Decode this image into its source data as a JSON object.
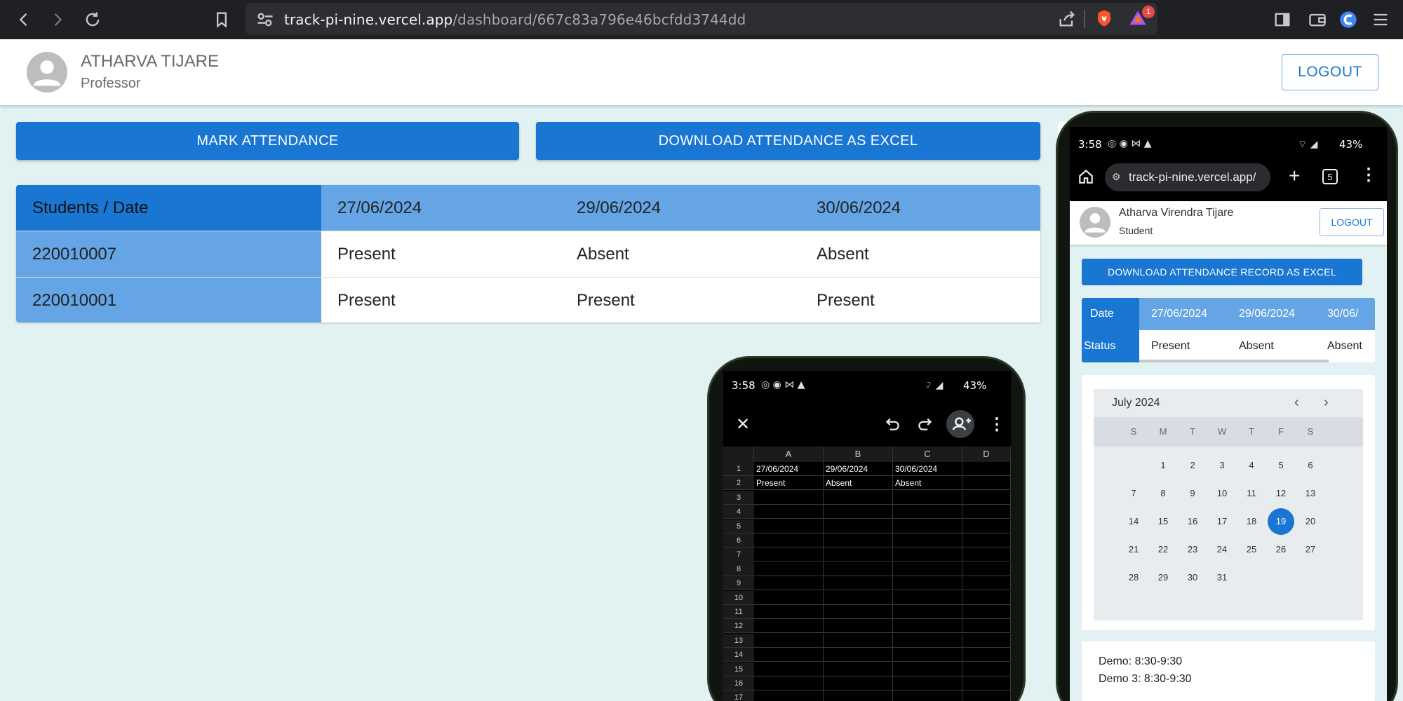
{
  "browser": {
    "url_host": "track-pi-nine.vercel.app",
    "url_path": "/dashboard/667c83a796e46bcfdd3744dd",
    "brave_badge": "1"
  },
  "header": {
    "user_name": "ATHARVA TIJARE",
    "user_role": "Professor",
    "logout_label": "LOGOUT"
  },
  "actions": {
    "mark_label": "MARK ATTENDANCE",
    "download_label": "DOWNLOAD ATTENDANCE AS EXCEL"
  },
  "table": {
    "corner": "Students / Date",
    "dates": [
      "27/06/2024",
      "29/06/2024",
      "30/06/2024"
    ],
    "rows": [
      {
        "id": "220010007",
        "values": [
          "Present",
          "Absent",
          "Absent"
        ]
      },
      {
        "id": "220010001",
        "values": [
          "Present",
          "Present",
          "Present"
        ]
      }
    ]
  },
  "sheets_phone": {
    "time": "3:58",
    "battery": "43%",
    "columns": [
      "A",
      "B",
      "C",
      "D"
    ],
    "rows": [
      [
        "27/06/2024",
        "29/06/2024",
        "30/06/2024",
        ""
      ],
      [
        "Present",
        "Absent",
        "Absent",
        ""
      ]
    ],
    "row_numbers": [
      "1",
      "2",
      "3",
      "4",
      "5",
      "6",
      "7",
      "8",
      "9",
      "10",
      "11",
      "12",
      "13",
      "14",
      "15",
      "16",
      "17"
    ]
  },
  "student_phone": {
    "time": "3:58",
    "battery": "43%",
    "url": "track-pi-nine.vercel.app/",
    "tab_count": "5",
    "user_name": "Atharva Virendra Tijare",
    "user_role": "Student",
    "logout_label": "LOGOUT",
    "download_label": "DOWNLOAD ATTENDANCE RECORD AS EXCEL",
    "date_label": "Date",
    "status_label": "Status",
    "dates": [
      "27/06/2024",
      "29/06/2024",
      "30/06/"
    ],
    "statuses": [
      "Present",
      "Absent",
      "Absent"
    ],
    "calendar": {
      "month": "July 2024",
      "weekdays": [
        "S",
        "M",
        "T",
        "W",
        "T",
        "F",
        "S"
      ],
      "selected": "19",
      "weeks": [
        [
          "",
          "1",
          "2",
          "3",
          "4",
          "5",
          "6"
        ],
        [
          "7",
          "8",
          "9",
          "10",
          "11",
          "12",
          "13"
        ],
        [
          "14",
          "15",
          "16",
          "17",
          "18",
          "19",
          "20"
        ],
        [
          "21",
          "22",
          "23",
          "24",
          "25",
          "26",
          "27"
        ],
        [
          "28",
          "29",
          "30",
          "31",
          "",
          "",
          ""
        ]
      ]
    },
    "schedule": [
      "Demo: 8:30-9:30",
      "Demo 3: 8:30-9:30"
    ]
  }
}
